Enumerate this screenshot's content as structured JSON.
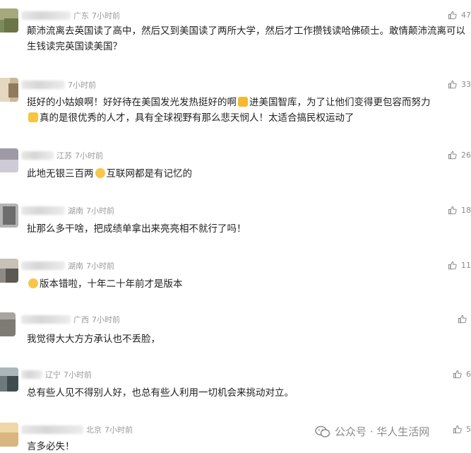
{
  "comments": [
    {
      "name": "",
      "location": "广东",
      "time": "7小时前",
      "likes": "47",
      "text": "颠沛流离去英国读了高中，然后又到美国读了两所大学，然后才工作攒钱读哈佛硕士。敢情颠沛流离可以生钱读完英国读美国？"
    },
    {
      "name": "",
      "location": "",
      "time": "7小时前",
      "likes": "33",
      "text": "挺好的小姑娘啊！好好待在美国发光发热挺好的啊",
      "emoji1": "thumbs-up-emoji",
      "text_b": "进美国智库，为了让他们变得更包容而努力",
      "emoji2": "flexed-biceps-emoji",
      "text_c": "真的是很优秀的人才，具有全球视野有那么悲天悯人！太适合搞民权运动了"
    },
    {
      "name": "",
      "location": "江苏",
      "time": "7小时前",
      "likes": "26",
      "text": "此地无银三百两",
      "emoji1": "sweat-smile-emoji",
      "text_b": "互联网都是有记忆的"
    },
    {
      "name": "",
      "location": "湖南",
      "time": "7小时前",
      "likes": "18",
      "text": "扯那么多干啥，把成绩单拿出来亮亮相不就行了吗！"
    },
    {
      "name": "",
      "location": "湖南",
      "time": "7小时前",
      "likes": "11",
      "text": "版本错啦，十年二十年前才是版本",
      "emoji0": "laughing-emoji"
    },
    {
      "name": "",
      "location": "广西",
      "time": "7小时前",
      "likes": "",
      "text": "我觉得大大方方承认也不丢脸，"
    },
    {
      "name": "",
      "location": "辽宁",
      "time": "7小时前",
      "likes": "6",
      "text": "总有些人见不得别人好，也总有些人利用一切机会来挑动对立。"
    },
    {
      "name": "",
      "location": "北京",
      "time": "7小时前",
      "likes": "5",
      "text": "言多必失！"
    }
  ],
  "watermark": {
    "text": "公众号 · 华人生活网"
  },
  "colors": {
    "meta": "#9a9a9a",
    "text": "#1f1f1f",
    "thumb": "#8c8c8c"
  }
}
